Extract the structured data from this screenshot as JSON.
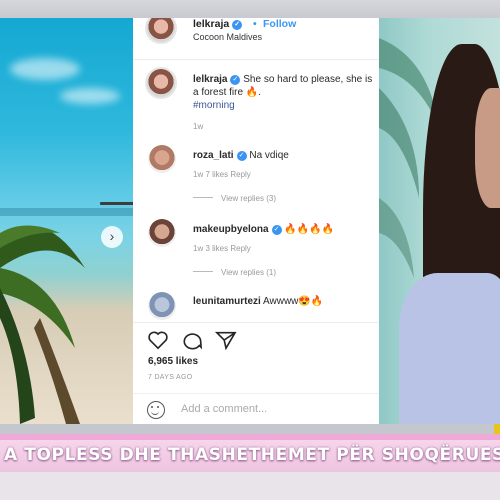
{
  "post": {
    "username": "lelkraja",
    "follow_label": "Follow",
    "separator": "•",
    "location": "Cocoon Maldives",
    "caption_username": "lelkraja",
    "caption_text": "She so hard to please, she is a forest fire 🔥.",
    "caption_hashtag": "#morning",
    "caption_time": "1w",
    "likes": "6,965 likes",
    "days_ago": "7 DAYS AGO",
    "add_comment_placeholder": "Add a comment..."
  },
  "comments": [
    {
      "username": "roza_lati",
      "text": "Na vdiqe",
      "meta": "1w   7 likes   Reply",
      "view_replies": "View replies (3)"
    },
    {
      "username": "makeupbyelona",
      "text": "🔥🔥🔥🔥",
      "meta": "1w   3 likes   Reply",
      "view_replies": "View replies (1)"
    },
    {
      "username": "leunitamurtezi",
      "text": "Awwww😍🔥"
    }
  ],
  "icons": {
    "like": "heart-icon",
    "comment": "comment-icon",
    "share": "send-icon",
    "emoji": "smiley-icon",
    "next": "chevron-right-icon"
  },
  "ticker": {
    "text": "A TOPLESS DHE THASHETHEMET PËR SHOQËRUESIN"
  },
  "colors": {
    "link_blue": "#3897f0",
    "verified_blue": "#3b95f0",
    "ticker_pink": "#f0a9d6",
    "hashtag": "#3c5a96"
  }
}
